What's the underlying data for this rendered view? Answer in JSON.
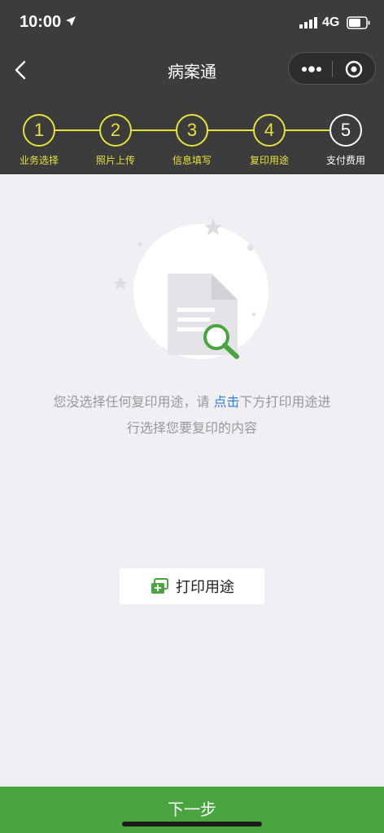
{
  "status_bar": {
    "time": "10:00",
    "network": "4G"
  },
  "nav": {
    "title": "病案通"
  },
  "steps": [
    {
      "number": "1",
      "label": "业务选择",
      "state": "done"
    },
    {
      "number": "2",
      "label": "照片上传",
      "state": "done"
    },
    {
      "number": "3",
      "label": "信息填写",
      "state": "done"
    },
    {
      "number": "4",
      "label": "复印用途",
      "state": "current"
    },
    {
      "number": "5",
      "label": "支付费用",
      "state": "pending"
    }
  ],
  "empty_state": {
    "message_part1": "您没选择任何复印用途，请 ",
    "link": "点击",
    "message_part2": "下方打印用途进行选择您要复印的内容"
  },
  "print_use_button": {
    "label": "打印用途"
  },
  "footer": {
    "next_label": "下一步"
  },
  "colors": {
    "header_bg": "#3c3c3c",
    "step_accent": "#e8e23a",
    "primary_green": "#4aa540",
    "link_blue": "#2f7fd6",
    "page_bg": "#efeff4"
  },
  "icons": [
    "location-arrow-icon",
    "signal-icon",
    "battery-icon",
    "back-arrow-icon",
    "more-icon",
    "close-miniprogram-icon",
    "document-search-icon",
    "print-icon"
  ]
}
